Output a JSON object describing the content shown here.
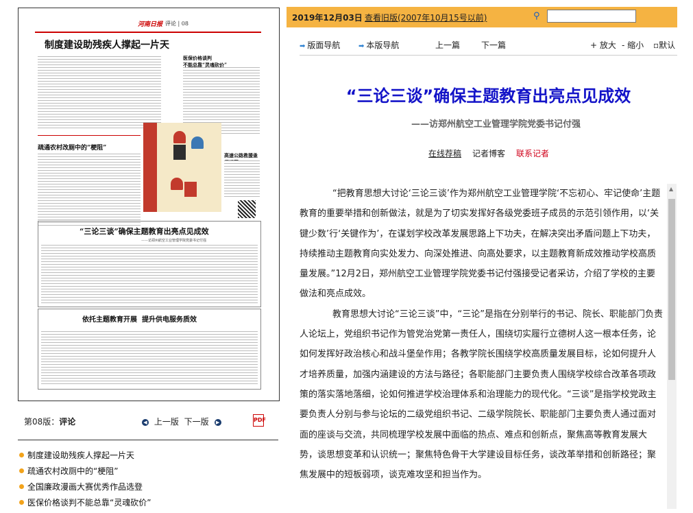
{
  "newspaper": {
    "logo": "河南日报",
    "section": "评论 | 08",
    "headlines": {
      "top": "制度建设助残疾人撑起一片天",
      "side": "医保价格谈判\n不能总靠“灵魂砍价”",
      "mid": "疏通农村改厕中的“梗阻”",
      "right_mid": "高速公路救援亟须规范",
      "main": "“三论三谈”确保主题教育出亮点见成效",
      "main_sub": "——访郑州航空工业管理学院党委书记付强",
      "bottom": "依托主题教育开展  提升供电服务质效"
    }
  },
  "page_bar": {
    "label": "第08版：",
    "label_bold": "评论",
    "prev": "上一版",
    "next": "下一版"
  },
  "article_list": [
    "制度建设助残疾人撑起一片天",
    "疏通农村改厕中的“梗阻”",
    "全国廉政漫画大赛优秀作品选登",
    "医保价格谈判不能总靠“灵魂砍价”"
  ],
  "header": {
    "date": "2019年12月03日",
    "old_version": "查看旧版(2007年10月15号以前)",
    "search_placeholder": ""
  },
  "toolbar": {
    "layout_nav": "版面导航",
    "page_nav": "本版导航",
    "prev_article": "上一篇",
    "next_article": "下一篇",
    "zoom_in": "放大",
    "zoom_out": "缩小",
    "default": "默认"
  },
  "article": {
    "title": "“三论三谈”确保主题教育出亮点见成效",
    "subtitle": "——访郑州航空工业管理学院党委书记付强",
    "links": {
      "submit": "在线荐稿",
      "blog": "记者博客",
      "contact": "联系记者"
    },
    "paragraphs": [
      "“把教育思想大讨论‘三论三谈’作为郑州航空工业管理学院‘不忘初心、牢记使命’主题教育的重要举措和创新做法，就是为了切实发挥好各级党委班子成员的示范引领作用，以‘关键少数’行‘关键作为’，在谋划学校改革发展思路上下功夫，在解决突出矛盾问题上下功夫，持续推动主题教育向实处发力、向深处推进、向高处要求，以主题教育新成效推动学校高质量发展。”12月2日，郑州航空工业管理学院党委书记付强接受记者采访，介绍了学校的主要做法和亮点成效。",
      "教育思想大讨论“三论三谈”中，“三论”是指在分别举行的书记、院长、职能部门负责人论坛上，党组织书记作为管党治党第一责任人，围绕切实履行立德树人这一根本任务，论如何发挥好政治核心和战斗堡垒作用；各教学院长围绕学校高质量发展目标，论如何提升人才培养质量，加强内涵建设的方法与路径；各职能部门主要负责人围绕学校综合改革各项政策的落实落地落细，论如何推进学校治理体系和治理能力的现代化。“三谈”是指学校党政主要负责人分别与参与论坛的二级党组织书记、二级学院院长、职能部门主要负责人通过面对面的座谈与交流，共同梳理学校发展中面临的热点、难点和创新点，聚焦高等教育发展大势，谈思想变革和认识统一；聚焦特色骨干大学建设目标任务，谈改革举措和创新路径；聚焦发展中的短板弱项，谈克难攻坚和担当作为。"
    ]
  }
}
